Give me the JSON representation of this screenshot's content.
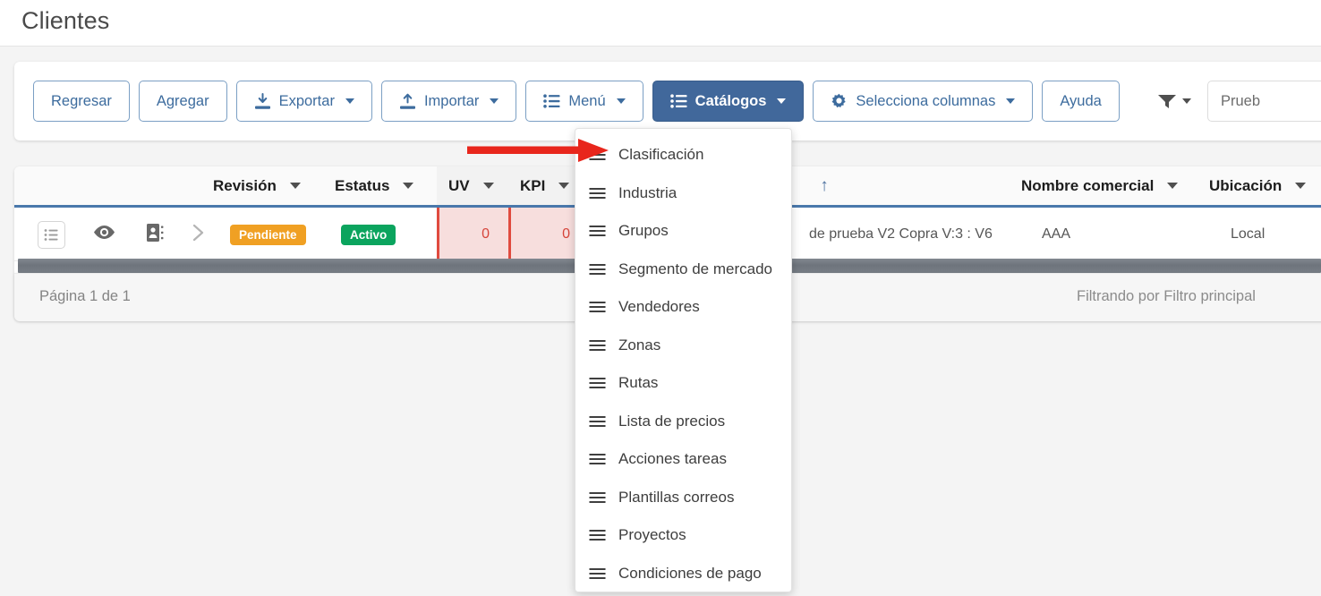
{
  "page": {
    "title": "Clientes"
  },
  "toolbar": {
    "buttons": [
      {
        "label": "Regresar",
        "icon": "none",
        "caret": false,
        "primary": false
      },
      {
        "label": "Agregar",
        "icon": "none",
        "caret": false,
        "primary": false
      },
      {
        "label": "Exportar",
        "icon": "download-icon",
        "caret": true,
        "primary": false
      },
      {
        "label": "Importar",
        "icon": "upload-icon",
        "caret": true,
        "primary": false
      },
      {
        "label": "Menú",
        "icon": "list-icon",
        "caret": true,
        "primary": false
      },
      {
        "label": "Catálogos",
        "icon": "list-icon",
        "caret": true,
        "primary": true
      },
      {
        "label": "Selecciona columnas",
        "icon": "gear-icon",
        "caret": true,
        "primary": false
      },
      {
        "label": "Ayuda",
        "icon": "none",
        "caret": false,
        "primary": false
      }
    ],
    "filter_icon": "funnel-icon",
    "search": {
      "value": "Prueb",
      "placeholder": ""
    }
  },
  "catalogs_menu": {
    "open": true,
    "items": [
      {
        "label": "Clasificación",
        "icon": "list-icon"
      },
      {
        "label": "Industria",
        "icon": "list-icon"
      },
      {
        "label": "Grupos",
        "icon": "list-icon"
      },
      {
        "label": "Segmento de mercado",
        "icon": "list-icon"
      },
      {
        "label": "Vendedores",
        "icon": "list-icon"
      },
      {
        "label": "Zonas",
        "icon": "list-icon"
      },
      {
        "label": "Rutas",
        "icon": "list-icon"
      },
      {
        "label": "Lista de precios",
        "icon": "list-icon"
      },
      {
        "label": "Acciones tareas",
        "icon": "list-icon"
      },
      {
        "label": "Plantillas correos",
        "icon": "list-icon"
      },
      {
        "label": "Proyectos",
        "icon": "list-icon"
      },
      {
        "label": "Condiciones de pago",
        "icon": "list-icon"
      }
    ]
  },
  "grid": {
    "columns": [
      {
        "key": "revision",
        "label": "Revisión",
        "sortable": true,
        "sort": ""
      },
      {
        "key": "estatus",
        "label": "Estatus",
        "sortable": true,
        "sort": ""
      },
      {
        "key": "uv",
        "label": "UV",
        "sortable": true,
        "sort": ""
      },
      {
        "key": "kpi",
        "label": "KPI",
        "sortable": true,
        "sort": ""
      },
      {
        "key": "nombre",
        "label": "",
        "sortable": true,
        "sort": "asc"
      },
      {
        "key": "comercial",
        "label": "Nombre comercial",
        "sortable": true,
        "sort": ""
      },
      {
        "key": "ubicacion",
        "label": "Ubicación",
        "sortable": true,
        "sort": ""
      }
    ],
    "sort_indicator": "↑",
    "rows": [
      {
        "row_actions_icon": "list-lines-icon",
        "view_icon": "eye-icon",
        "contact_icon": "contact-card-icon",
        "expand_icon": "chevron-right-icon",
        "revision": "Pendiente",
        "estatus": "Activo",
        "uv": "0",
        "kpi": "0",
        "nombre": "de prueba V2 Copra V:3 : V6",
        "comercial": "AAA",
        "ubicacion": "Local"
      }
    ]
  },
  "footer": {
    "page_info": "Página 1 de 1",
    "filter_info": "Filtrando por Filtro principal"
  },
  "colors": {
    "primary": "#41689b",
    "link": "#3d6c9e",
    "header_underline": "#4a78ab",
    "warn_badge": "#f0a023",
    "ok_badge": "#0ba45e",
    "alert_cell_bg": "#f7dedd",
    "alert_cell_border": "#e04b3f",
    "alert_text": "#d6443a",
    "annotation_arrow": "#e8261c",
    "page_bg": "#f4f4f4"
  }
}
